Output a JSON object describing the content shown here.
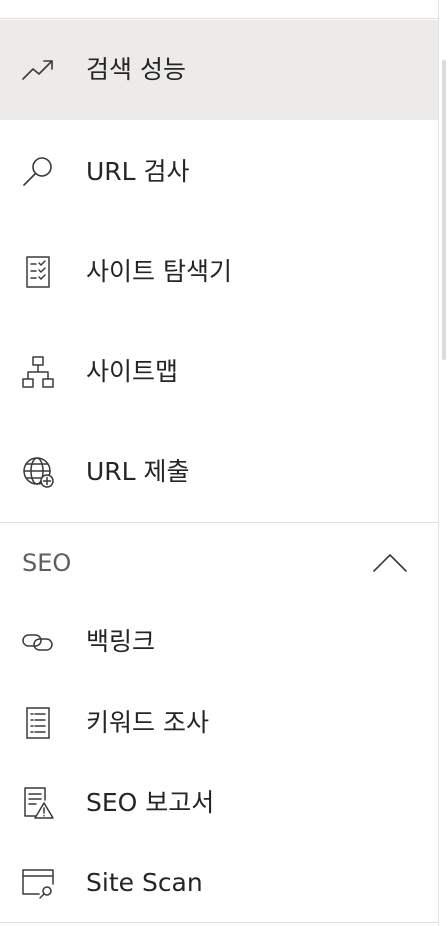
{
  "nav": {
    "items": [
      {
        "label": "검색 성능",
        "icon": "trending-up-icon",
        "active": true
      },
      {
        "label": "URL 검사",
        "icon": "search-icon",
        "active": false
      },
      {
        "label": "사이트 탐색기",
        "icon": "checklist-icon",
        "active": false
      },
      {
        "label": "사이트맵",
        "icon": "sitemap-icon",
        "active": false
      },
      {
        "label": "URL 제출",
        "icon": "globe-add-icon",
        "active": false
      }
    ],
    "seo_section": {
      "title": "SEO",
      "expanded": true,
      "items": [
        {
          "label": "백링크",
          "icon": "link-icon"
        },
        {
          "label": "키워드 조사",
          "icon": "document-list-icon"
        },
        {
          "label": "SEO 보고서",
          "icon": "report-warning-icon"
        },
        {
          "label": "Site Scan",
          "icon": "browser-search-icon"
        }
      ]
    }
  },
  "colors": {
    "active_background": "#edebe9",
    "text": "#252525",
    "section_title": "#605e5c",
    "divider": "#e1e1e1"
  }
}
